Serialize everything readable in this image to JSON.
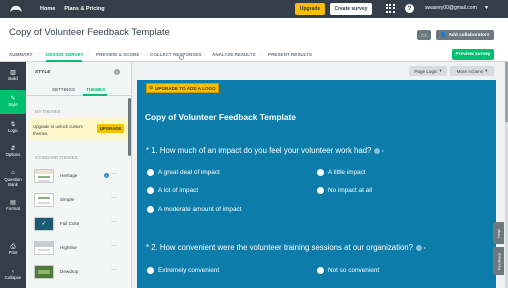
{
  "topnav": {
    "links": [
      "Home",
      "Plans & Pricing"
    ],
    "upgrade_label": "Upgrade",
    "create_survey_label": "Create survey",
    "user": "swasrey00@gmail.com"
  },
  "survey": {
    "title": "Copy of Volunteer Feedback Template",
    "add_collaborators_label": "Add collaborators",
    "preview_label": "Preview survey"
  },
  "steps": [
    "SUMMARY",
    "DESIGN SURVEY",
    "PREVIEW & SCORE",
    "COLLECT RESPONSES",
    "ANALYZE RESULTS",
    "PRESENT RESULTS"
  ],
  "active_step": "DESIGN SURVEY",
  "rail": [
    {
      "label": "Build",
      "icon": "bar-chart-icon"
    },
    {
      "label": "Style",
      "icon": "brush-icon"
    },
    {
      "label": "Logic",
      "icon": "logic-icon"
    },
    {
      "label": "Options",
      "icon": "sliders-icon"
    },
    {
      "label": "Question Bank",
      "icon": "bank-icon"
    },
    {
      "label": "Format",
      "icon": "format-icon"
    },
    {
      "label": "Print",
      "icon": "printer-icon"
    },
    {
      "label": "Collapse",
      "icon": "chevron-left-icon"
    }
  ],
  "panel": {
    "title": "STYLE",
    "tabs": [
      "SETTINGS",
      "THEMES"
    ],
    "active_tab": "THEMES",
    "my_themes_label": "MY THEMES",
    "upgrade_text": "Upgrade to unlock custom themes.",
    "upgrade_button": "UPGRADE",
    "standard_label": "STANDARD THEMES",
    "themes": [
      {
        "name": "Heritage",
        "badge": "i"
      },
      {
        "name": "Simple"
      },
      {
        "name": "Full Color"
      },
      {
        "name": "Highrise"
      },
      {
        "name": "Dewdrop"
      }
    ]
  },
  "canvas": {
    "page_logic_label": "Page Logic",
    "more_actions_label": "More Actions",
    "add_logo_label": "UPGRADE TO ADD A LOGO",
    "page_title": "Copy of Volunteer Feedback Template",
    "questions": [
      {
        "text": "* 1. How much of an impact do you feel your volunteer work had?",
        "options": [
          "A great deal of impact",
          "A little impact",
          "A lot of impact",
          "No impact at all",
          "A moderate amount of impact"
        ]
      },
      {
        "text": "* 2. How convenient were the volunteer training sessions at our organization?",
        "options": [
          "Extremely convenient",
          "Not so convenient"
        ]
      }
    ]
  },
  "side_tabs": [
    "Help!",
    "Feedback"
  ],
  "colors": {
    "nav": "#333e48",
    "accent": "#00bf6f",
    "upgrade": "#f9be00",
    "survey_bg": "#0c7caa"
  }
}
